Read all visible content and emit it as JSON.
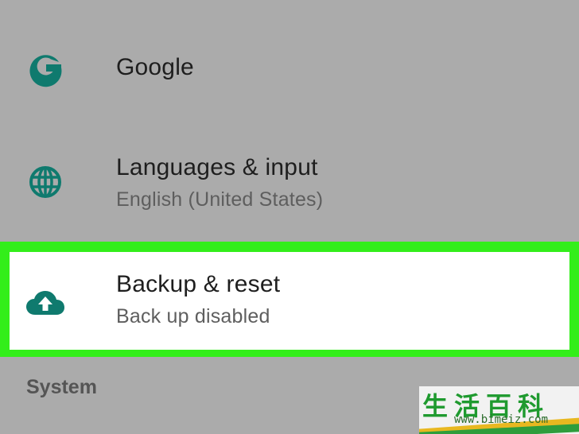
{
  "theme": {
    "background": "#ababab",
    "icon_color": "#0f7a6e",
    "highlight_border": "#33ee1a",
    "highlight_fill": "#ffffff"
  },
  "settings": {
    "items": [
      {
        "icon": "google-g-icon",
        "title": "Google"
      },
      {
        "icon": "globe-icon",
        "title": "Languages & input",
        "subtitle": "English (United States)"
      },
      {
        "icon": "cloud-upload-icon",
        "title": "Backup & reset",
        "subtitle": "Back up disabled",
        "highlighted": true
      }
    ],
    "section_header": "System"
  },
  "watermark": {
    "title": "生活百科",
    "url": "www.bimeiz.com"
  }
}
